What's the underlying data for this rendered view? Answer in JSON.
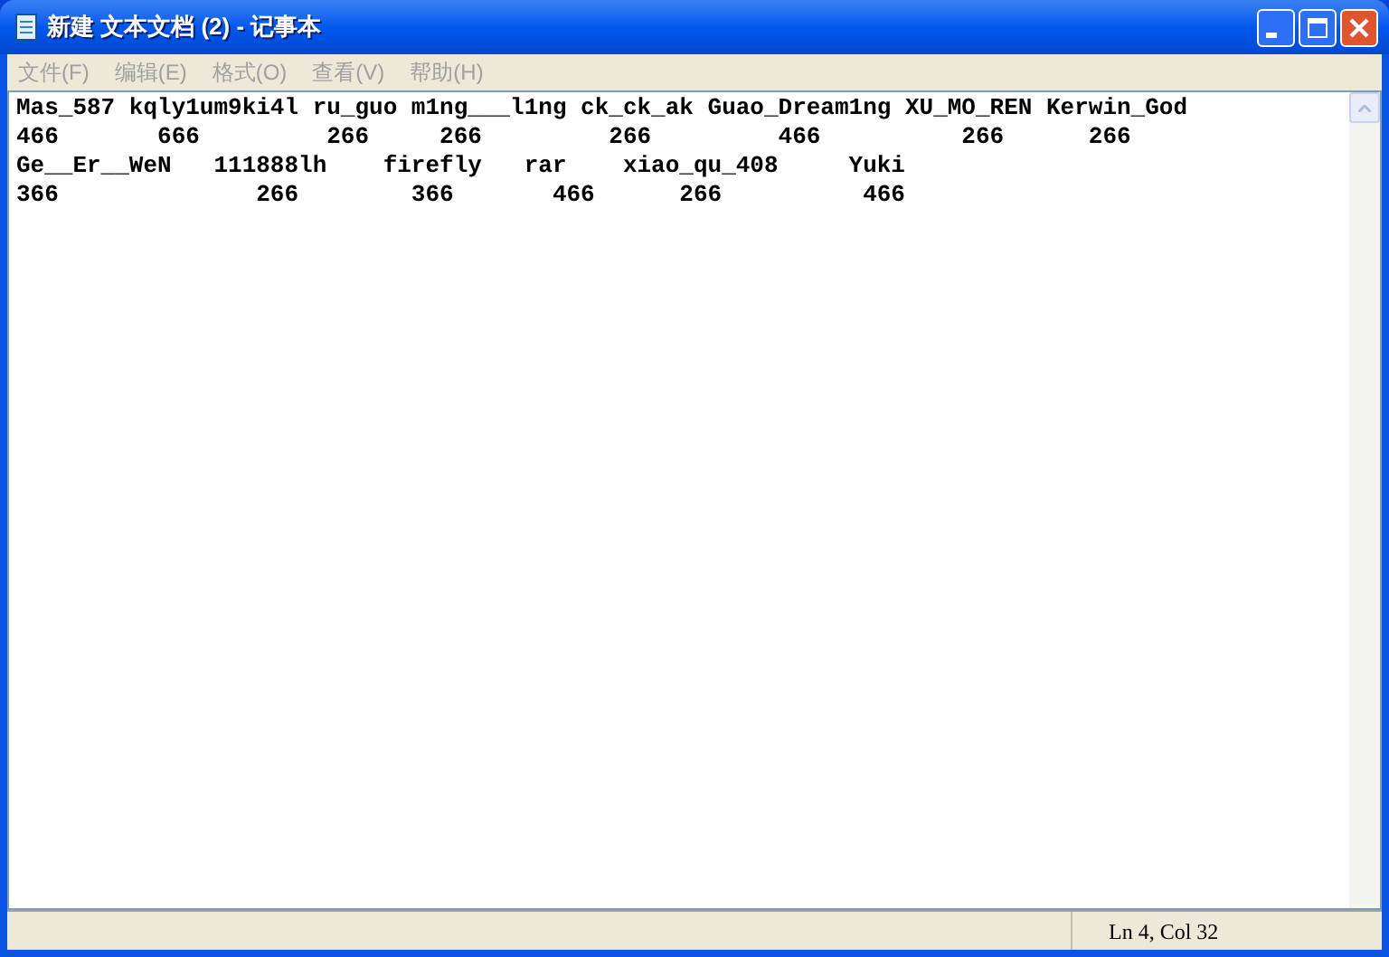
{
  "window": {
    "title": "新建 文本文档 (2) - 记事本"
  },
  "menu": [
    "文件(F)",
    "编辑(E)",
    "格式(O)",
    "查看(V)",
    "帮助(H)"
  ],
  "document": {
    "lines": [
      "Mas_587 kqly1um9ki4l ru_guo m1ng___l1ng ck_ck_ak Guao_Dream1ng XU_MO_REN Kerwin_God",
      "466       666         266     266         266         466          266      266",
      "Ge__Er__WeN   111888lh    firefly   rar    xiao_qu_408     Yuki",
      "366              266        366       466      266          466"
    ]
  },
  "status_bar": {
    "position": "Ln 4, Col 32"
  }
}
